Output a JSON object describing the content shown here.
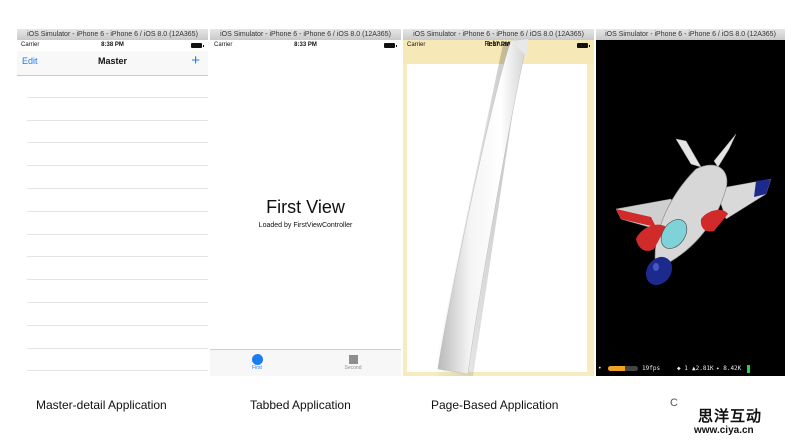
{
  "simulator_title": "iOS Simulator - iPhone 6 - iPhone 6 / iOS 8.0 (12A365)",
  "master": {
    "carrier": "Carrier",
    "time": "8:38 PM",
    "nav_left": "Edit",
    "nav_title": "Master",
    "nav_right": "+"
  },
  "tabbed": {
    "carrier": "Carrier",
    "time": "8:33 PM",
    "heading": "First View",
    "subheading": "Loaded by FirstViewController",
    "tabs": [
      {
        "label": "First",
        "icon": "circle-icon",
        "selected": true
      },
      {
        "label": "Second",
        "icon": "square-icon",
        "selected": false
      }
    ]
  },
  "page_based": {
    "carrier": "Carrier",
    "time": "8:37 PM",
    "month": "February"
  },
  "game": {
    "fps": "19fps",
    "stat_nodes": "◆ 1",
    "stat_triangles": "▲2.81K",
    "stat_draws": "✦ 8.42K",
    "fps_fraction": 0.55
  },
  "captions": {
    "master": "Master-detail Application",
    "tabbed": "Tabbed Application",
    "page": "Page-Based Application",
    "game": "C"
  },
  "watermark": {
    "chinese": "思洋互动",
    "url": "www.ciya.cn"
  },
  "colors": {
    "ios_blue": "#1a7cf2",
    "page_cream": "#f6e8b7",
    "fps_bar": "#f1a224",
    "jet_red": "#d12a2a",
    "jet_blue": "#1b2a8c"
  }
}
